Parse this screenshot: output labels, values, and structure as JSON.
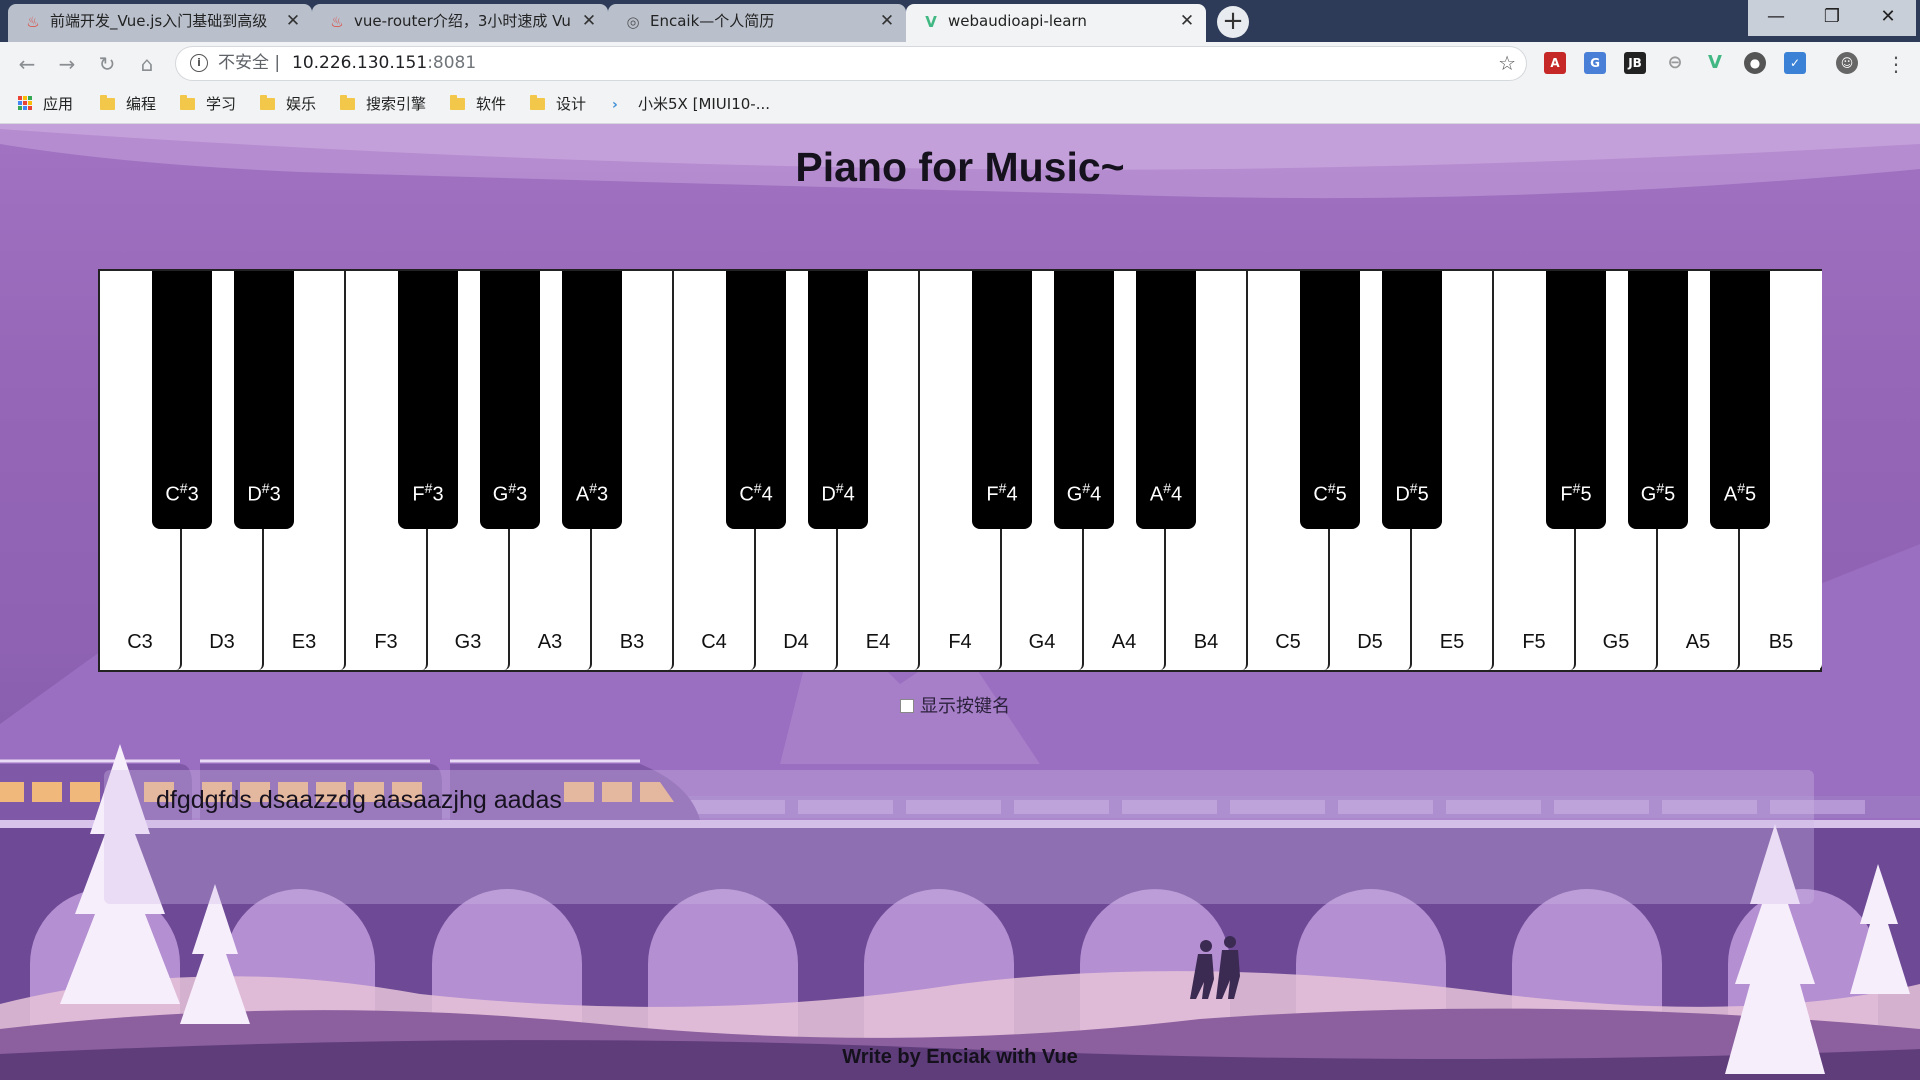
{
  "browser": {
    "tabs": [
      {
        "title": "前端开发_Vue.js入门基础到高级",
        "icon": "fire-icon"
      },
      {
        "title": "vue-router介绍，3小时速成 Vu",
        "icon": "fire-icon"
      },
      {
        "title": "Encaik—个人简历",
        "icon": "globe-icon"
      },
      {
        "title": "webaudioapi-learn",
        "icon": "vue-icon"
      }
    ],
    "new_tab": "+",
    "window_controls": {
      "minimize": "—",
      "maximize": "❐",
      "close": "✕"
    },
    "address": {
      "security_label": "不安全",
      "separator": "|",
      "host": "10.226.130.151",
      "port": ":8081"
    },
    "bookmarks": [
      "应用",
      "编程",
      "学习",
      "娱乐",
      "搜索引擎",
      "软件",
      "设计",
      "小米5X [MIUI10-..."
    ]
  },
  "page": {
    "title": "Piano for Music~",
    "show_keys_label": "显示按键名",
    "show_keys_checked": false,
    "input_text": "dfgdgfds dsaazzdg aasaazjhg aadas",
    "footer": "Write by Enciak with Vue",
    "white_keys": [
      "C3",
      "D3",
      "E3",
      "F3",
      "G3",
      "A3",
      "B3",
      "C4",
      "D4",
      "E4",
      "F4",
      "G4",
      "A4",
      "B4",
      "C5",
      "D5",
      "E5",
      "F5",
      "G5",
      "A5",
      "B5"
    ],
    "black_keys": [
      {
        "note": "C",
        "octave": "3"
      },
      {
        "note": "D",
        "octave": "3"
      },
      {
        "note": "F",
        "octave": "3"
      },
      {
        "note": "G",
        "octave": "3"
      },
      {
        "note": "A",
        "octave": "3"
      },
      {
        "note": "C",
        "octave": "4"
      },
      {
        "note": "D",
        "octave": "4"
      },
      {
        "note": "F",
        "octave": "4"
      },
      {
        "note": "G",
        "octave": "4"
      },
      {
        "note": "A",
        "octave": "4"
      },
      {
        "note": "C",
        "octave": "5"
      },
      {
        "note": "D",
        "octave": "5"
      },
      {
        "note": "F",
        "octave": "5"
      },
      {
        "note": "G",
        "octave": "5"
      },
      {
        "note": "A",
        "octave": "5"
      }
    ]
  },
  "colors": {
    "page_top": "#a273c2",
    "page_bottom": "#6c4a90",
    "train_window": "#f0b87a",
    "tab_bar": "#2d3b58"
  }
}
